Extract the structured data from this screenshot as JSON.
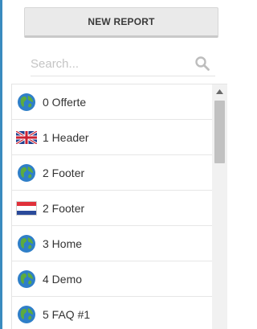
{
  "toolbar": {
    "new_report_label": "NEW REPORT"
  },
  "search": {
    "placeholder": "Search...",
    "value": "",
    "icon": "search-icon"
  },
  "report_list": {
    "items": [
      {
        "label": "0 Offerte",
        "icon": "globe-icon"
      },
      {
        "label": "1 Header",
        "icon": "uk-flag-icon"
      },
      {
        "label": "2 Footer",
        "icon": "globe-icon"
      },
      {
        "label": "2 Footer",
        "icon": "netherlands-flag-icon"
      },
      {
        "label": "3 Home",
        "icon": "globe-icon"
      },
      {
        "label": "4 Demo",
        "icon": "globe-icon"
      },
      {
        "label": "5 FAQ #1",
        "icon": "globe-icon"
      }
    ]
  },
  "colors": {
    "accent_rule": "#3a8bbf",
    "button_bg": "#eaeaea",
    "text": "#333333"
  }
}
